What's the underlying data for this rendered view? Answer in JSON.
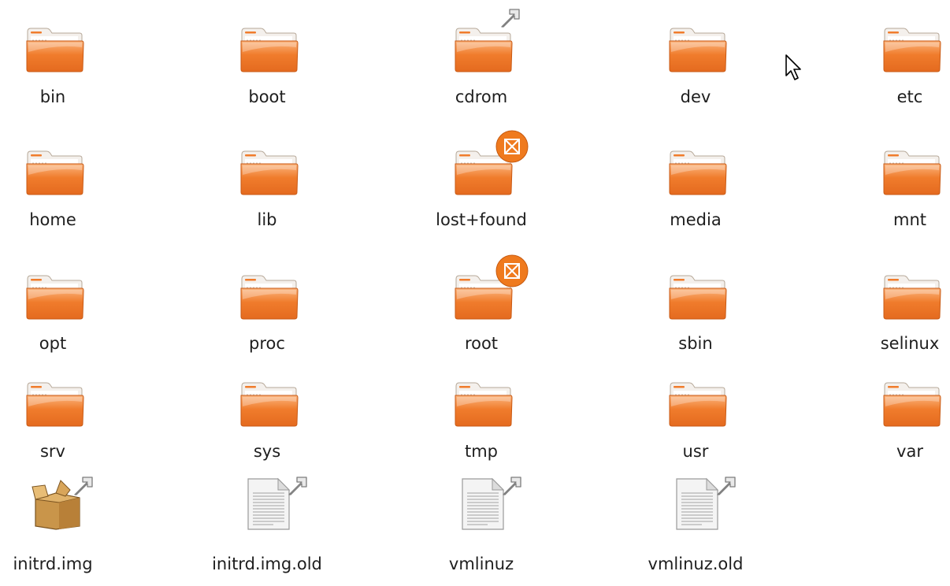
{
  "window": {
    "type": "file-manager-icon-view"
  },
  "items": [
    {
      "label": "bin",
      "kind": "folder",
      "emblem": null
    },
    {
      "label": "boot",
      "kind": "folder",
      "emblem": null
    },
    {
      "label": "cdrom",
      "kind": "folder",
      "emblem": "symlink-arrow"
    },
    {
      "label": "dev",
      "kind": "folder",
      "emblem": null
    },
    {
      "label": "etc",
      "kind": "folder",
      "emblem": null
    },
    {
      "label": "home",
      "kind": "folder",
      "emblem": null
    },
    {
      "label": "lib",
      "kind": "folder",
      "emblem": null
    },
    {
      "label": "lost+found",
      "kind": "folder",
      "emblem": "unreadable"
    },
    {
      "label": "media",
      "kind": "folder",
      "emblem": null
    },
    {
      "label": "mnt",
      "kind": "folder",
      "emblem": null
    },
    {
      "label": "opt",
      "kind": "folder",
      "emblem": null
    },
    {
      "label": "proc",
      "kind": "folder",
      "emblem": null
    },
    {
      "label": "root",
      "kind": "folder",
      "emblem": "unreadable"
    },
    {
      "label": "sbin",
      "kind": "folder",
      "emblem": null
    },
    {
      "label": "selinux",
      "kind": "folder",
      "emblem": null
    },
    {
      "label": "srv",
      "kind": "folder",
      "emblem": null
    },
    {
      "label": "sys",
      "kind": "folder",
      "emblem": null
    },
    {
      "label": "tmp",
      "kind": "folder",
      "emblem": null
    },
    {
      "label": "usr",
      "kind": "folder",
      "emblem": null
    },
    {
      "label": "var",
      "kind": "folder",
      "emblem": null
    },
    {
      "label": "initrd.img",
      "kind": "package",
      "emblem": "symlink-arrow"
    },
    {
      "label": "initrd.img.old",
      "kind": "document",
      "emblem": "symlink-arrow"
    },
    {
      "label": "vmlinuz",
      "kind": "document",
      "emblem": "symlink-arrow"
    },
    {
      "label": "vmlinuz.old",
      "kind": "document",
      "emblem": "symlink-arrow"
    }
  ],
  "colors": {
    "folder_orange": "#f07c2c",
    "folder_light": "#fbbf8c",
    "emblem_orange": "#ef7a1e",
    "label_text": "#1e1e1e"
  },
  "cursor": {
    "icon": "mouse-pointer-icon"
  }
}
